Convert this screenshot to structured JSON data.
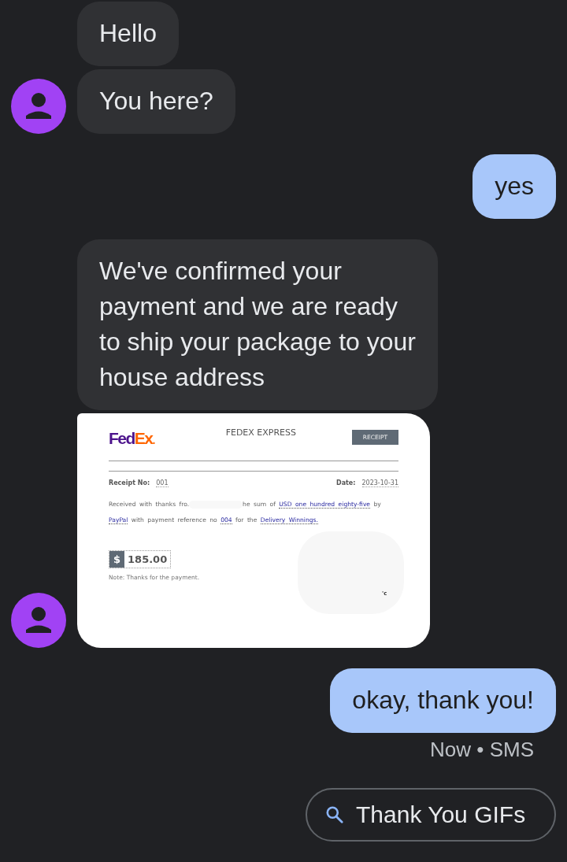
{
  "messages": [
    {
      "kind": "text",
      "outgoing": false,
      "avatar": false,
      "text": "Hello"
    },
    {
      "kind": "text",
      "outgoing": false,
      "avatar": true,
      "text": "You here?"
    },
    {
      "kind": "text",
      "outgoing": true,
      "text": "yes"
    },
    {
      "kind": "text",
      "outgoing": false,
      "avatar": false,
      "text": "We've confirmed your\npayment and we are ready\nto ship your package to your\nhouse address"
    },
    {
      "kind": "receipt",
      "outgoing": false,
      "avatar": true,
      "receipt": {
        "logo_left": "Fed",
        "logo_right": "Ex",
        "logo_dot": ".",
        "company": "FEDEX EXPRESS",
        "badge": "RECEIPT",
        "number_label": "Receipt No:",
        "number": "001",
        "date_label": "Date:",
        "date": "2023-10-31",
        "body": [
          {
            "kind": "plain",
            "text": "Received with thanks fro."
          },
          {
            "kind": "redaction"
          },
          {
            "kind": "plain",
            "text": "he sum of "
          },
          {
            "kind": "link",
            "text": "USD one hundred eighty-five"
          },
          {
            "kind": "plain",
            "text": " by "
          },
          {
            "kind": "link",
            "text": "PayPal"
          },
          {
            "kind": "plain",
            "text": " with payment reference no "
          },
          {
            "kind": "link",
            "text": "004"
          },
          {
            "kind": "plain",
            "text": " for the "
          },
          {
            "kind": "link",
            "text": "Delivery Winnings."
          }
        ],
        "currency": "$",
        "amount": "185.00",
        "note": "Note: Thanks for the payment.",
        "signature_fragment": "'c"
      }
    },
    {
      "kind": "text",
      "outgoing": true,
      "text": "okay, thank you!"
    }
  ],
  "status": "Now • SMS",
  "suggestion": {
    "label": "Thank You GIFs"
  }
}
